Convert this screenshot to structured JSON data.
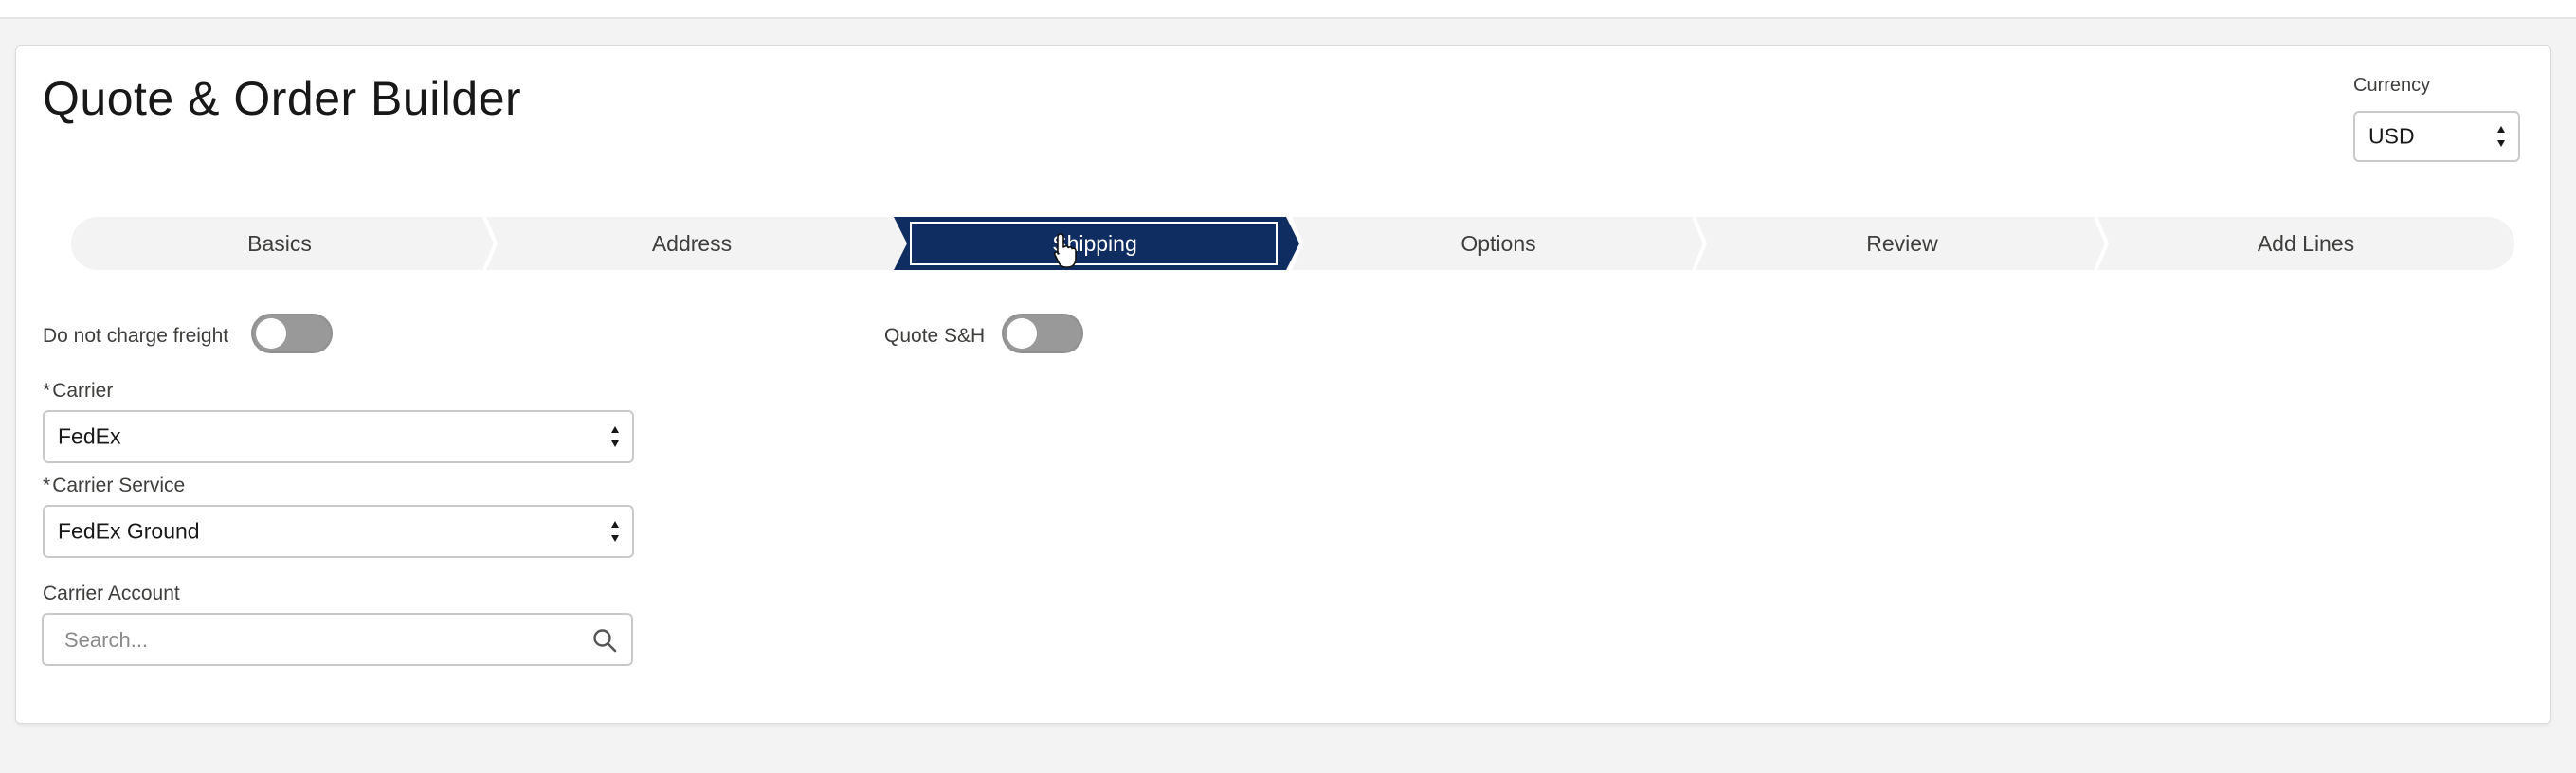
{
  "page": {
    "title": "Quote & Order Builder"
  },
  "currency": {
    "label": "Currency",
    "value": "USD"
  },
  "path": {
    "stages": [
      {
        "label": "Basics",
        "active": false
      },
      {
        "label": "Address",
        "active": false
      },
      {
        "label": "Shipping",
        "active": true
      },
      {
        "label": "Options",
        "active": false
      },
      {
        "label": "Review",
        "active": false
      },
      {
        "label": "Add Lines",
        "active": false
      }
    ]
  },
  "form": {
    "do_not_charge_freight": {
      "label": "Do not charge freight",
      "on": false
    },
    "quote_sh": {
      "label": "Quote S&H",
      "on": false
    },
    "carrier": {
      "required_mark": "*",
      "label": "Carrier",
      "value": "FedEx"
    },
    "carrier_service": {
      "required_mark": "*",
      "label": "Carrier Service",
      "value": "FedEx Ground"
    },
    "carrier_account": {
      "label": "Carrier Account",
      "placeholder": "Search..."
    }
  },
  "colors": {
    "active_stage": "#0f2d61",
    "inactive_stage": "#f3f3f3",
    "toggle_off": "#999999"
  },
  "icons": [
    "search-icon",
    "select-arrows-icon",
    "pointer-cursor-icon"
  ]
}
